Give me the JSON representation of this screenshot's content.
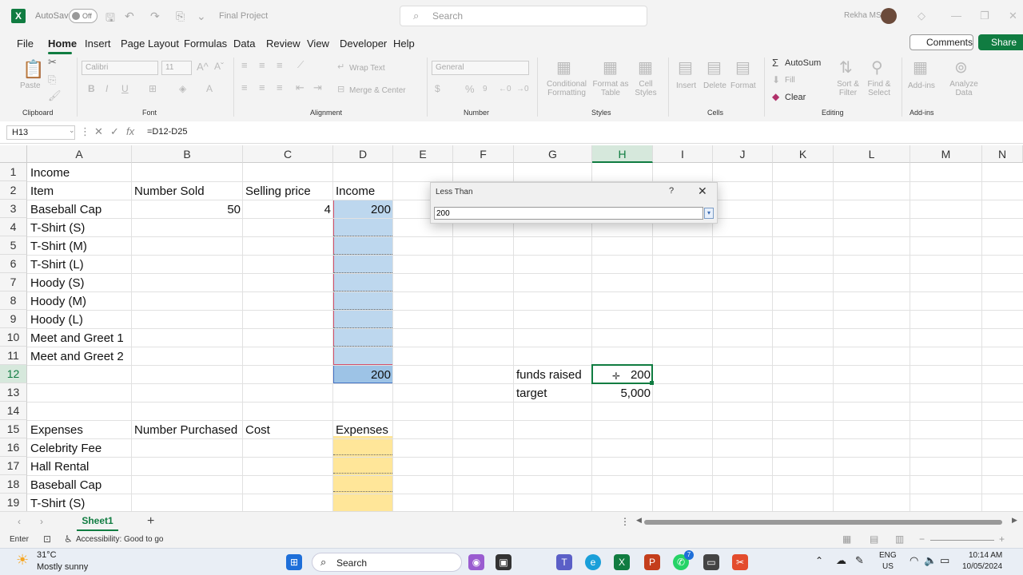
{
  "titlebar": {
    "autosave_label": "AutoSave",
    "autosave_state": "Off",
    "filename": "Final Project",
    "search_placeholder": "Search",
    "user_name": "Rekha MS"
  },
  "menu": {
    "tabs": [
      "File",
      "Home",
      "Insert",
      "Page Layout",
      "Formulas",
      "Data",
      "Review",
      "View",
      "Developer",
      "Help"
    ],
    "active": "Home",
    "comments_label": "Comments",
    "share_label": "Share"
  },
  "ribbon": {
    "clipboard": {
      "paste": "Paste",
      "group": "Clipboard"
    },
    "font": {
      "name": "Calibri",
      "size": "11",
      "group": "Font"
    },
    "alignment": {
      "wrap": "Wrap Text",
      "merge": "Merge & Center",
      "group": "Alignment"
    },
    "number": {
      "format": "General",
      "group": "Number"
    },
    "styles": {
      "conditional": "Conditional Formatting",
      "format_table": "Format as Table",
      "cell_styles": "Cell Styles",
      "group": "Styles"
    },
    "cells": {
      "insert": "Insert",
      "delete": "Delete",
      "format": "Format",
      "group": "Cells"
    },
    "editing": {
      "autosum": "AutoSum",
      "fill": "Fill",
      "clear": "Clear",
      "sort": "Sort & Filter",
      "find": "Find & Select",
      "group": "Editing"
    },
    "addins": {
      "addins": "Add-ins",
      "analyze": "Analyze Data",
      "group": "Add-ins"
    }
  },
  "formula_bar": {
    "name_box": "H13",
    "formula": "=D12-D25"
  },
  "grid": {
    "columns": [
      "A",
      "B",
      "C",
      "D",
      "E",
      "F",
      "G",
      "H",
      "I",
      "J",
      "K",
      "L",
      "M",
      "N"
    ],
    "selected_column": "H",
    "rows": [
      "1",
      "2",
      "3",
      "4",
      "5",
      "6",
      "7",
      "8",
      "9",
      "10",
      "11",
      "12",
      "13",
      "14",
      "15",
      "16",
      "17",
      "18",
      "19"
    ],
    "selected_row": "12",
    "cells": {
      "A1": "Income",
      "A2": "Item",
      "B2": "Number Sold",
      "C2": "Selling price",
      "D2": "Income",
      "A3": "Baseball Cap",
      "B3": "50",
      "C3": "4",
      "D3": "200",
      "A4": "T-Shirt (S)",
      "A5": "T-Shirt (M)",
      "A6": "T-Shirt (L)",
      "A7": "Hoody (S)",
      "A8": "Hoody (M)",
      "A9": "Hoody (L)",
      "A10": "Meet and Greet 1",
      "A11": "Meet and Greet 2",
      "D12": "200",
      "G12": "funds raised",
      "H12": "200",
      "G13": "target",
      "H13": "5,000",
      "A15": "Expenses",
      "B15": "Number Purchased",
      "C15": "Cost",
      "D15": "Expenses",
      "A16": "Celebrity Fee",
      "A17": "Hall Rental",
      "A18": "Baseball Cap",
      "A19": "T-Shirt (S)"
    }
  },
  "dialog": {
    "title": "Less Than",
    "help": "?",
    "close": "✕",
    "value": "200"
  },
  "sheets": {
    "tabs": [
      "Sheet1"
    ],
    "active": "Sheet1"
  },
  "status": {
    "mode": "Enter",
    "accessibility": "Accessibility: Good to go"
  },
  "taskbar": {
    "weather_temp": "31°C",
    "weather_desc": "Mostly sunny",
    "search": "Search",
    "lang": "ENG",
    "region": "US",
    "time": "10:14 AM",
    "date": "10/05/2024",
    "notification_badge": "7"
  }
}
